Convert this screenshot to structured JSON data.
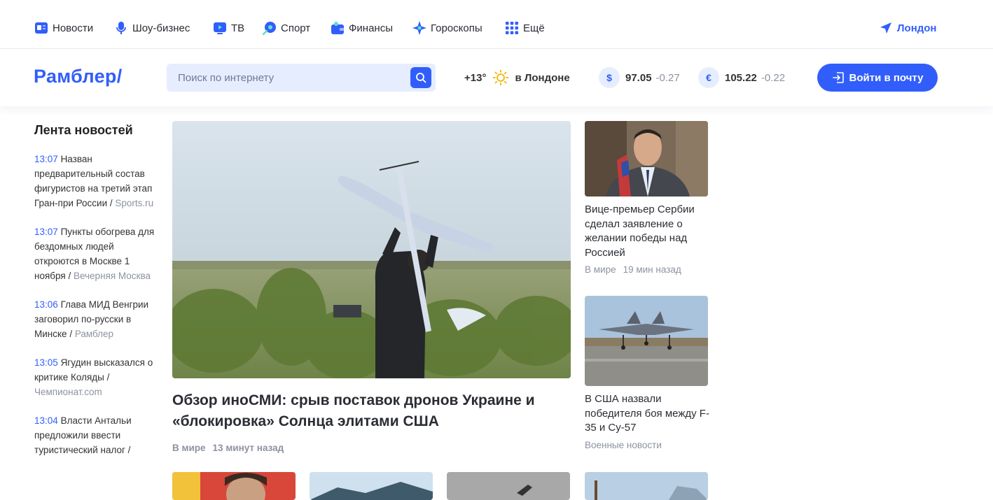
{
  "topnav": {
    "items": [
      {
        "label": "Новости",
        "icon": "news-icon"
      },
      {
        "label": "Шоу-бизнес",
        "icon": "microphone-icon"
      },
      {
        "label": "ТВ",
        "icon": "tv-icon"
      },
      {
        "label": "Спорт",
        "icon": "ball-icon"
      },
      {
        "label": "Финансы",
        "icon": "wallet-icon"
      },
      {
        "label": "Гороскопы",
        "icon": "star-icon"
      },
      {
        "label": "Ещё",
        "icon": "grid-icon"
      }
    ],
    "location": "Лондон"
  },
  "header": {
    "logo": "Рамблер/",
    "search_placeholder": "Поиск по интернету",
    "weather": {
      "temp": "+13°",
      "city": "в Лондоне"
    },
    "usd": {
      "symbol": "$",
      "value": "97.05",
      "change": "-0.27"
    },
    "eur": {
      "symbol": "€",
      "value": "105.22",
      "change": "-0.22"
    },
    "login_label": "Войти в почту"
  },
  "feed": {
    "title": "Лента новостей",
    "items": [
      {
        "time": "13:07",
        "text": "Назван предварительный состав фигуристов на третий этап Гран-при России",
        "source": "Sports.ru"
      },
      {
        "time": "13:07",
        "text": "Пункты обогрева для бездомных людей откроются в Москве 1 ноября",
        "source": "Вечерняя Москва"
      },
      {
        "time": "13:06",
        "text": "Глава МИД Венгрии заговорил по-русски в Минске",
        "source": "Рамблер"
      },
      {
        "time": "13:05",
        "text": "Ягудин высказался о критике Коляды",
        "source": "Чемпионат.com"
      },
      {
        "time": "13:04",
        "text": "Власти Антальи предложили ввести туристический налог",
        "source": ""
      }
    ]
  },
  "main_article": {
    "title": "Обзор иноСМИ: срыв поставок дронов Украине и «блокировка» Солнца элитами США",
    "category": "В мире",
    "time": "13 минут назад"
  },
  "side_articles": [
    {
      "title": "Вице-премьер Сербии сделал заявление о желании победы над Россией",
      "category": "В мире",
      "time": "19 мин назад"
    },
    {
      "title": "В США назвали победителя боя между F-35 и Су-57",
      "category": "Военные новости",
      "time": ""
    }
  ],
  "colors": {
    "accent": "#315efb",
    "muted": "#8c92a0",
    "search_bg": "#e6edfe"
  }
}
